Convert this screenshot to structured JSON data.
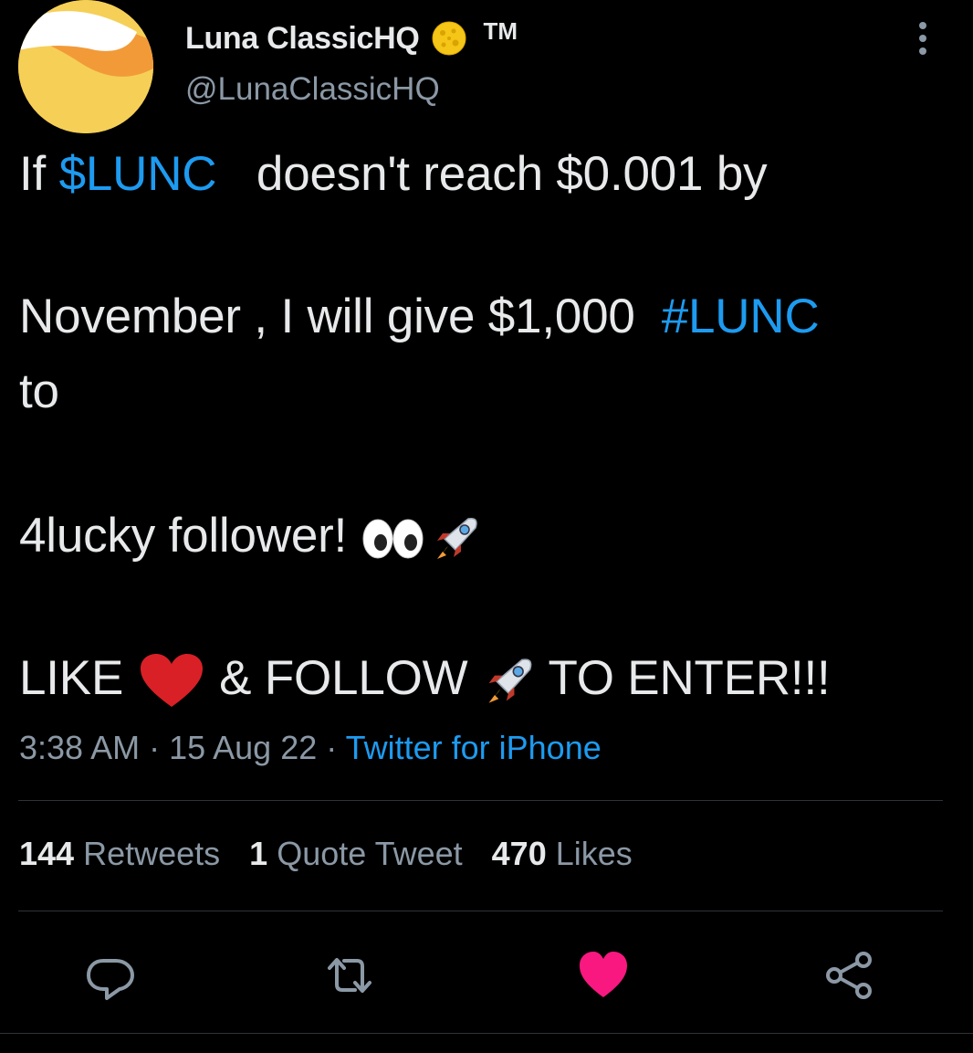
{
  "author": {
    "display_name": "Luna ClassicHQ",
    "name_emoji": "moon-emoji",
    "trademark": "TM",
    "handle": "@LunaClassicHQ"
  },
  "tweet": {
    "line1_prefix": "If ",
    "line1_cashtag": "$LUNC",
    "line1_suffix": "   doesn't reach $0.001 by",
    "line2_prefix": "November , I will give $1,000  ",
    "line2_hashtag": "#LUNC",
    "line3": "to",
    "line4": "4lucky follower! ",
    "line5_like": "LIKE ",
    "line5_follow": " & FOLLOW ",
    "line5_enter": " TO ENTER!!!"
  },
  "meta": {
    "time": "3:38 AM",
    "sep1": " · ",
    "date": "15 Aug 22",
    "sep2": " · ",
    "source": "Twitter for iPhone"
  },
  "stats": {
    "retweets_count": "144",
    "retweets_label": " Retweets",
    "quotes_count": "1",
    "quotes_label": " Quote Tweet",
    "likes_count": "470",
    "likes_label": " Likes"
  },
  "colors": {
    "link": "#1d9bf0",
    "like_active": "#f91880",
    "muted": "#8b98a5"
  }
}
